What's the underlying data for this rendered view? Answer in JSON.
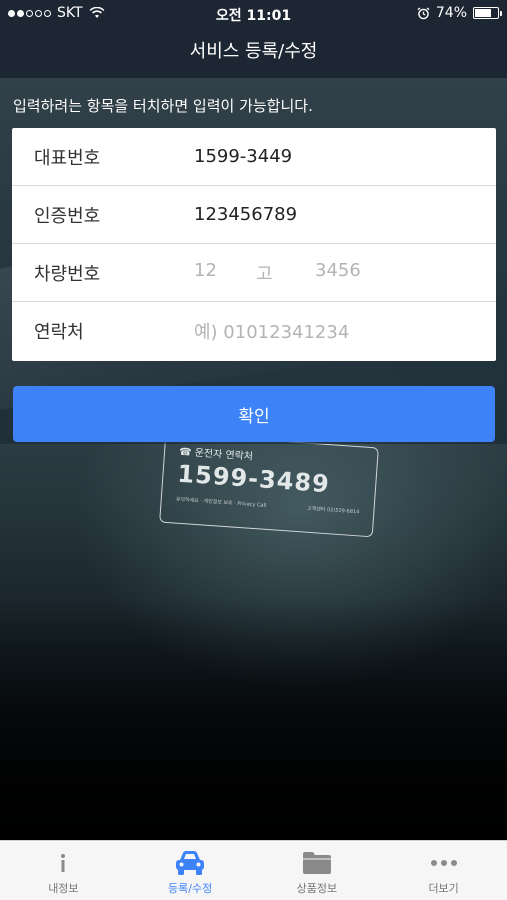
{
  "status_bar": {
    "carrier": "SKT",
    "time": "오전 11:01",
    "battery": "74%",
    "battery_level": 0.74
  },
  "nav": {
    "title": "서비스 등록/수정"
  },
  "hint": "입력하려는 항목을 터치하면 입력이 가능합니다.",
  "form": {
    "rows": [
      {
        "label": "대표번호",
        "value": "1599-3449"
      },
      {
        "label": "인증번호",
        "value": "123456789"
      },
      {
        "label": "차량번호",
        "plate": [
          "12",
          "고",
          "3456"
        ]
      },
      {
        "label": "연락처",
        "placeholder": "예) 01012341234"
      }
    ]
  },
  "confirm_label": "확인",
  "background_card": {
    "label": "운전자 연락처",
    "number": "1599-3489",
    "fine_left": "유의하세요 · 개인정보 보호 · Privacy Call",
    "fine_right": "고객센터 02)529-6814"
  },
  "tabs": [
    {
      "label": "내정보",
      "icon": "info-icon",
      "active": false
    },
    {
      "label": "등록/수정",
      "icon": "car-icon",
      "active": true
    },
    {
      "label": "상품정보",
      "icon": "folder-icon",
      "active": false
    },
    {
      "label": "더보기",
      "icon": "more-icon",
      "active": false
    }
  ],
  "colors": {
    "accent": "#3d82f6",
    "nav_bg": "#1d2733",
    "inactive_icon": "#8a8a8a"
  }
}
